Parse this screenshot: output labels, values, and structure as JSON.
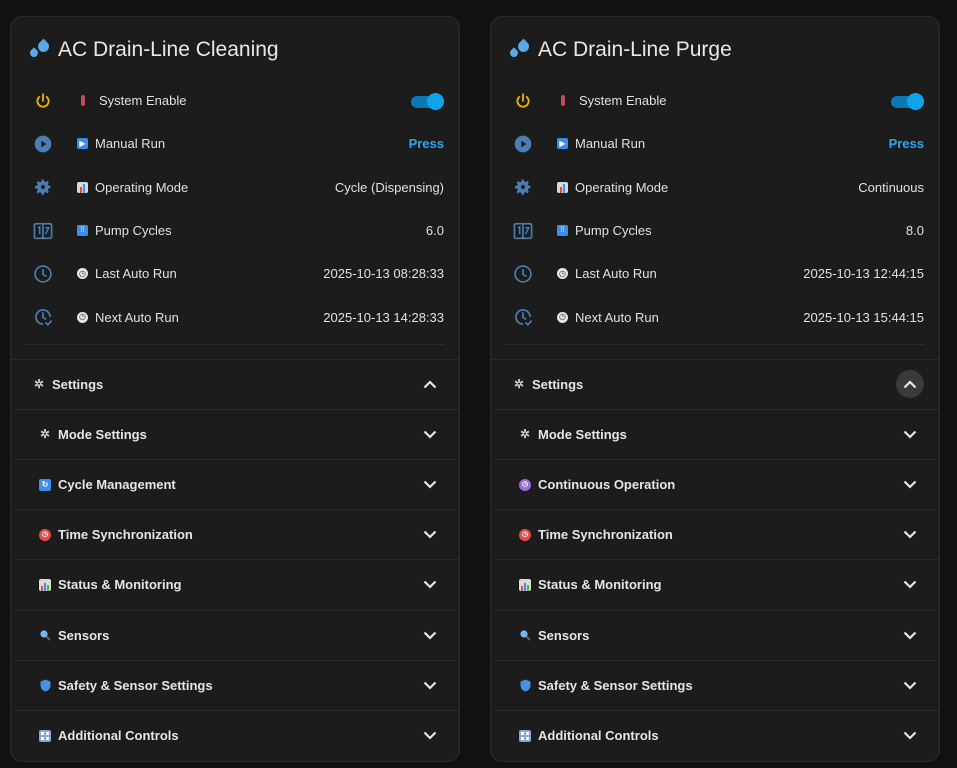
{
  "cards": [
    {
      "title": "AC Drain-Line Cleaning",
      "entities": {
        "system_enable": "System Enable",
        "manual_run": "Manual Run",
        "manual_run_state": "Press",
        "operating_mode": "Operating Mode",
        "operating_mode_state": "Cycle (Dispensing)",
        "pump_cycles": "Pump Cycles",
        "pump_cycles_state": "6.0",
        "last_auto_run": "Last Auto Run",
        "last_auto_run_state": "2025-10-13 08:28:33",
        "next_auto_run": "Next Auto Run",
        "next_auto_run_state": "2025-10-13 14:28:33"
      },
      "settings_label": "Settings",
      "sections": [
        "Mode Settings",
        "Cycle Management",
        "Time Synchronization",
        "Status & Monitoring",
        "Sensors",
        "Safety & Sensor Settings",
        "Additional Controls"
      ]
    },
    {
      "title": "AC Drain-Line Purge",
      "entities": {
        "system_enable": "System Enable",
        "manual_run": "Manual Run",
        "manual_run_state": "Press",
        "operating_mode": "Operating Mode",
        "operating_mode_state": "Continuous",
        "pump_cycles": "Pump Cycles",
        "pump_cycles_state": "8.0",
        "last_auto_run": "Last Auto Run",
        "last_auto_run_state": "2025-10-13 12:44:15",
        "next_auto_run": "Next Auto Run",
        "next_auto_run_state": "2025-10-13 15:44:15"
      },
      "settings_label": "Settings",
      "sections": [
        "Mode Settings",
        "Continuous Operation",
        "Time Synchronization",
        "Status & Monitoring",
        "Sensors",
        "Safety & Sensor Settings",
        "Additional Controls"
      ]
    }
  ],
  "colors": {
    "background": "#111111",
    "card": "#1c1c1c",
    "accent": "#2aa8ef",
    "toggle_on": "#0fa3ec",
    "power_icon": "#f2b400",
    "entity_icon": "#4a7fb5"
  },
  "icons": {
    "header": "water-drops-icon",
    "system_enable": "power-icon",
    "manual_run": "play-circle-icon",
    "operating_mode": "gear-icon",
    "pump_cycles": "counter-icon",
    "last_auto_run": "clock-icon",
    "next_auto_run": "clock-check-icon",
    "expand": "chevron-down-icon",
    "collapse": "chevron-up-icon"
  }
}
